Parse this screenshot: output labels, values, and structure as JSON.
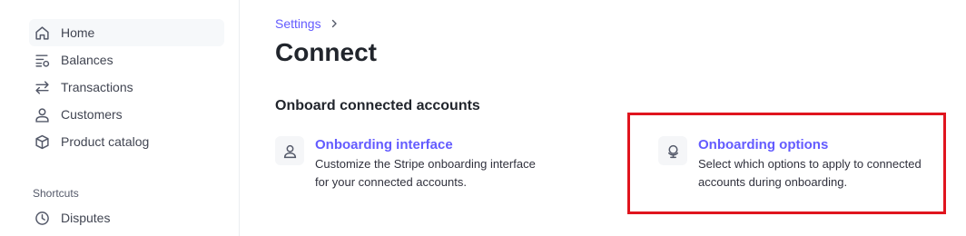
{
  "sidebar": {
    "items": [
      {
        "label": "Home",
        "icon": "home-icon",
        "active": true
      },
      {
        "label": "Balances",
        "icon": "balances-icon"
      },
      {
        "label": "Transactions",
        "icon": "transactions-icon"
      },
      {
        "label": "Customers",
        "icon": "customers-icon"
      },
      {
        "label": "Product catalog",
        "icon": "product-catalog-icon"
      }
    ],
    "shortcuts_label": "Shortcuts",
    "shortcuts": [
      {
        "label": "Disputes",
        "icon": "clock-icon"
      }
    ]
  },
  "breadcrumb": {
    "parent": "Settings",
    "separator_icon": "chevron-right-icon"
  },
  "page": {
    "title": "Connect",
    "section_title": "Onboard connected accounts"
  },
  "cards": [
    {
      "title": "Onboarding interface",
      "description": "Customize the Stripe onboarding interface for your connected accounts.",
      "icon": "person-icon"
    },
    {
      "title": "Onboarding options",
      "description": "Select which options to apply to connected accounts during onboarding.",
      "icon": "globe-stand-icon"
    }
  ],
  "colors": {
    "accent": "#635bff",
    "highlight": "#e0141e",
    "active_nav_bg": "#f6f8fa",
    "text": "#30313d"
  }
}
